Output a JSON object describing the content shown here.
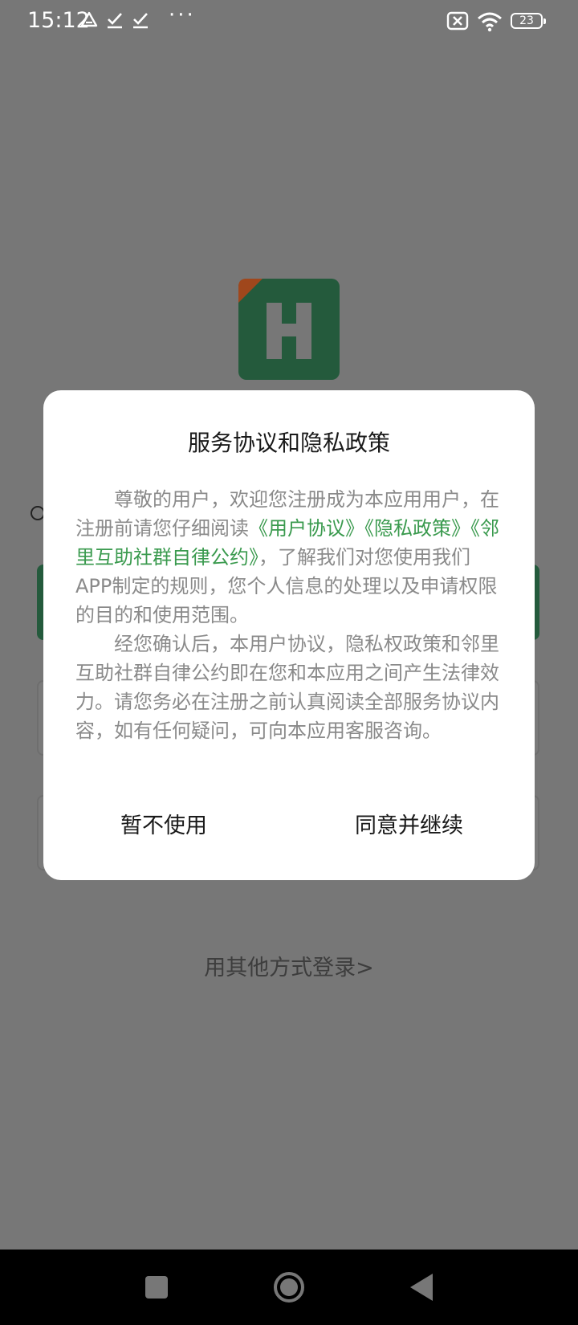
{
  "status_bar": {
    "time": "15:12",
    "battery": "23",
    "dots": "···",
    "icons": [
      "drive-icon",
      "check-icon",
      "check-icon",
      "sim-off-icon",
      "wifi-icon"
    ]
  },
  "colors": {
    "logo_green": "#245a3c",
    "logo_accent": "#a0471c",
    "link_green": "#3a9a4e"
  },
  "dialog": {
    "title": "服务协议和隐私政策",
    "p1_before": "尊敬的用户，欢迎您注册成为本应用用户，在注册前请您仔细阅读",
    "link_user_agreement": "《用户协议》",
    "link_privacy_policy": "《隐私政策》",
    "link_community_convention": "《邻里互助社群自律公约》",
    "p1_after": "，了解我们对您使用我们APP制定的规则，您个人信息的处理以及申请权限的目的和使用范围。",
    "p2": "经您确认后，本用户协议，隐私权政策和邻里互助社群自律公约即在您和本应用之间产生法律效力。请您务必在注册之前认真阅读全部服务协议内容，如有任何疑问，可向本应用客服咨询。",
    "decline_label": "暂不使用",
    "agree_label": "同意并继续"
  },
  "background": {
    "other_login_label": "用其他方式登录>"
  }
}
